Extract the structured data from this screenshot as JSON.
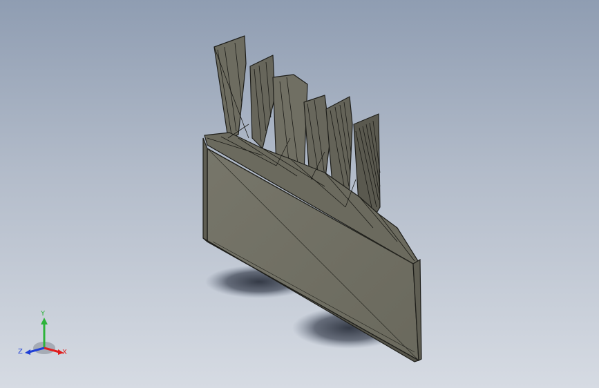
{
  "triad": {
    "x_label": "X",
    "y_label": "Y",
    "z_label": "Z",
    "x_color": "#e01e1e",
    "y_color": "#2db33a",
    "z_color": "#1f3fd6"
  },
  "model": {
    "face_color": "#6f6e62",
    "dark_face_color": "#5a594f",
    "edge_color": "#1e1e1a",
    "shadow_color": "#3a4150",
    "background_top": "#8f9db2",
    "background_bottom": "#d6dbe3"
  }
}
